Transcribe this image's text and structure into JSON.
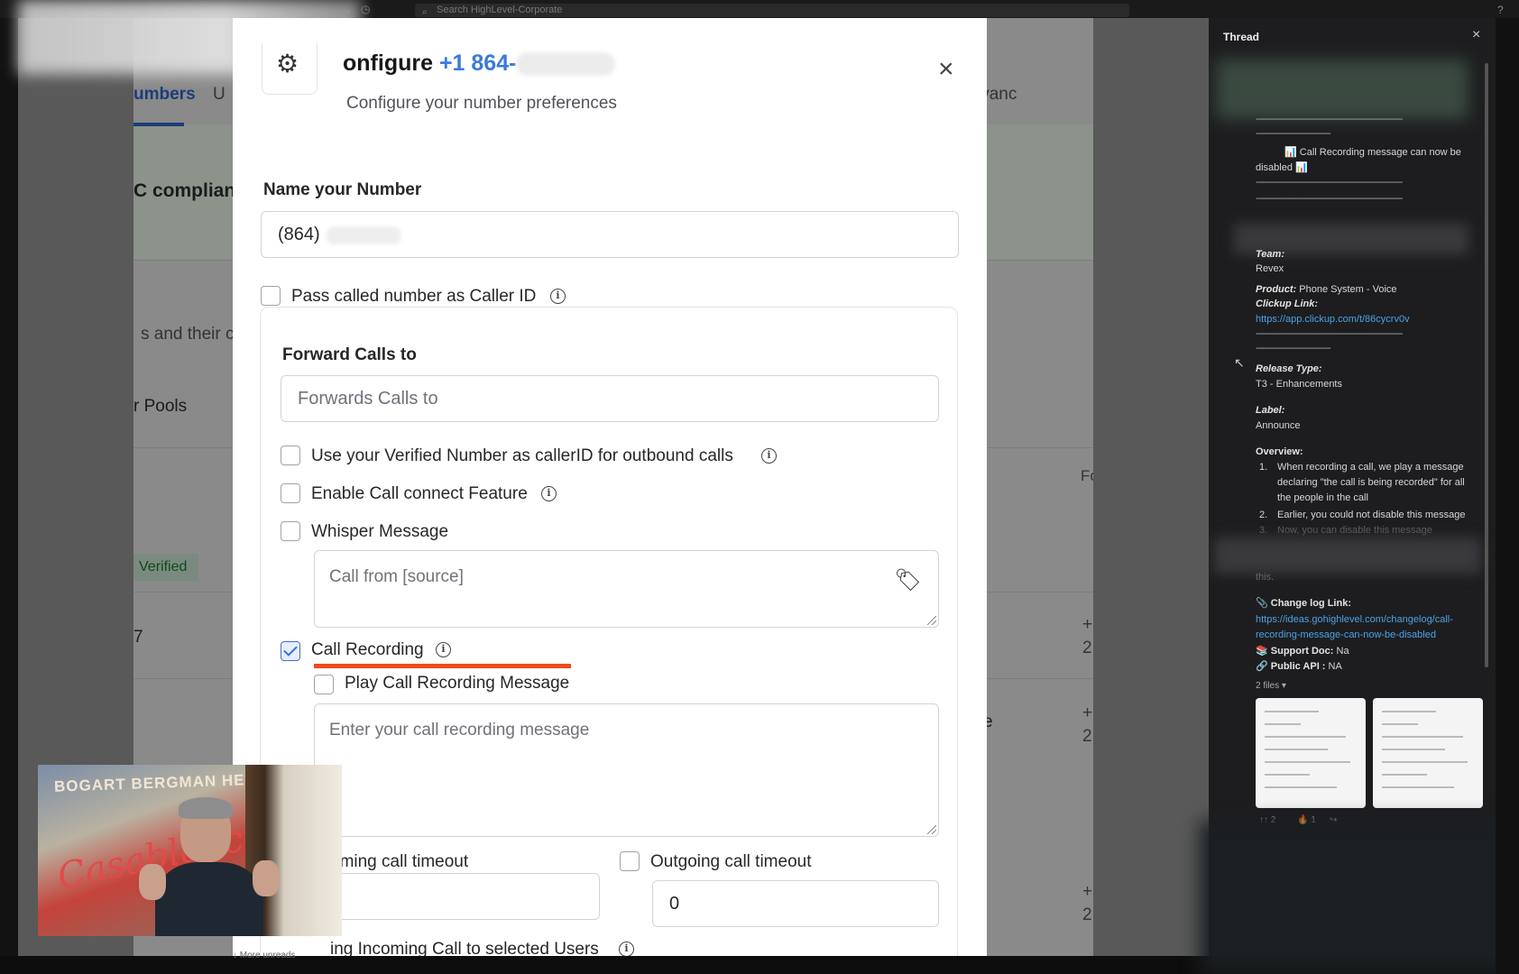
{
  "app": {
    "search_placeholder": "Search HighLevel-Corporate"
  },
  "background_page": {
    "tab_numbers": "umbers",
    "tab_u": "U",
    "tab_advanced": "Advanc",
    "banner_text": "C complian",
    "desc_text": "s and their co",
    "pools_button": "r Pools",
    "col_header": "Fo",
    "verified_badge": "Verified",
    "row_text_7": "7",
    "row_text_e": "e",
    "row_phone_1": "+1",
    "row_phone_2": "2!"
  },
  "modal": {
    "title_prefix": "onfigure",
    "title_phone": "+1 864-",
    "subtitle": "Configure your number preferences",
    "close_glyph": "×",
    "name_label": "Name your Number",
    "name_value": "(864)",
    "pass_caller_id_label": "Pass called number as Caller ID",
    "forward_label": "Forward Calls to",
    "forward_placeholder": "Forwards Calls to",
    "verified_callerid_label": "Use your Verified Number as callerID for outbound calls",
    "call_connect_label": "Enable Call connect Feature",
    "whisper_label": "Whisper Message",
    "whisper_placeholder": "Call from [source]",
    "call_recording_label": "Call Recording",
    "call_recording_checked": true,
    "play_recording_label": "Play Call Recording Message",
    "recording_placeholder": "Enter your call recording message",
    "incoming_timeout_label": "oming call timeout",
    "outgoing_timeout_label": "Outgoing call timeout",
    "outgoing_timeout_value": "0",
    "ring_incoming_label": "ing Incoming Call to selected Users",
    "accent_color": "#3b7ad9",
    "highlight_color": "#f24a1d"
  },
  "thread": {
    "title": "Thread",
    "close_glyph": "×",
    "dashes": "-------------------------------------------------------------",
    "dashes_short": "-------------------------------",
    "announcement": "Call Recording message can now be disabled",
    "team_label": "Team:",
    "team_value": "Revex",
    "product_label": "Product:",
    "product_value": "Phone System - Voice",
    "clickup_label": "Clickup Link:",
    "clickup_url": "https://app.clickup.com/t/86cycrv0v",
    "release_type_label": "Release Type:",
    "release_type_value": "T3 - Enhancements",
    "label_label": "Label:",
    "label_value": "Announce",
    "overview_label": "Overview:",
    "overview_items": [
      "When recording a call, we play a message declaring \"the call is being recorded\" for all the people in the call",
      "Earlier, you could not disable this message",
      "Now, you can disable this message"
    ],
    "overview_tail": "this.",
    "changelog_label": "Change log Link:",
    "changelog_url": "https://ideas.gohighlevel.com/changelog/call-recording-message-can-now-be-disabled",
    "support_doc_label": "Support Doc:",
    "support_doc_value": "Na",
    "public_api_label": "Public API :",
    "public_api_value": "NA",
    "files_count": "2 files",
    "reaction_1": "↑↑ 2",
    "reaction_2": "🔥 1"
  },
  "webcam": {
    "poster_top": "BOGART BERGMAN HENREID",
    "poster_script": "Casablanca"
  },
  "bottom_bar": {
    "more_unreads": "More unreads"
  }
}
